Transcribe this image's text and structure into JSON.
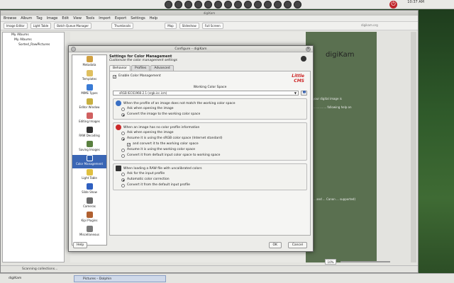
{
  "top_panel": {
    "clock": "10:37 AM"
  },
  "background_window": {
    "title": "digiKam",
    "menu": [
      "Browse",
      "Album",
      "Tag",
      "Image",
      "Edit",
      "View",
      "Tools",
      "Import",
      "Export",
      "Settings",
      "Help"
    ],
    "toolbar": [
      "Image Editor",
      "Light Table",
      "Batch Queue Manager",
      "Thumbnails",
      "Map",
      "Slideshow",
      "Full Screen"
    ],
    "tree": [
      "My Albums",
      "My Albums",
      "Sorted_RawPictures"
    ],
    "brand": "digiKam",
    "brand_domain": "digikam.org",
    "side_text": "your digital image is",
    "side_text2": "... ... ... ... following help on",
    "side_text3": "... and ... Canon ... supported)",
    "status": "Scanning collections...",
    "zoom": "10%"
  },
  "dialog": {
    "title": "Configure – digiKam",
    "heading": "Settings for Color Management",
    "subheading": "Customize the color management settings",
    "sidebar": [
      {
        "label": "Metadata",
        "color": "#d0a040"
      },
      {
        "label": "Templates",
        "color": "#e0c060"
      },
      {
        "label": "MIME Types",
        "color": "#3a7bd5"
      },
      {
        "label": "Editor Window",
        "color": "#c8b040"
      },
      {
        "label": "Editing Images",
        "color": "#d06060"
      },
      {
        "label": "RAW Decoding",
        "color": "#333333"
      },
      {
        "label": "Saving Images",
        "color": "#5a8040"
      },
      {
        "label": "Color Management",
        "color": "#2f5fb0"
      },
      {
        "label": "Light Table",
        "color": "#e0c040"
      },
      {
        "label": "Slide Show",
        "color": "#3060c0"
      },
      {
        "label": "Cameras",
        "color": "#6a6a6a"
      },
      {
        "label": "Kipi Plugins",
        "color": "#b06030"
      },
      {
        "label": "Miscellaneous",
        "color": "#7a7a7a"
      }
    ],
    "tabs": [
      "Behavior",
      "Profiles",
      "Advanced"
    ],
    "enable_label": "Enable Color Management",
    "logo": "Little CMS",
    "workspace_label": "Working Color Space",
    "workspace_value": "sRGB IEC61966-2.1 (srgb.icc.icm)",
    "mismatch": {
      "title": "When the profile of an image does not match the working color space",
      "options": [
        "Ask when opening the image",
        "Convert the image to the working color space"
      ],
      "selected": 1
    },
    "no_profile": {
      "title": "When an image has no color profile information",
      "options": [
        "Ask when opening the image",
        "Assume it is using the sRGB color space (Internet standard)",
        "and convert it to the working color space",
        "Assume it is using the working color space",
        "Convert it from default input color space to working space"
      ],
      "selected": 1
    },
    "raw": {
      "title": "When loading a RAW file with uncalibrated colors",
      "options": [
        "Ask for the input profile",
        "Automatic color correction",
        "Convert it from the default input profile"
      ],
      "selected": 1
    },
    "help_label": "Help",
    "ok_label": "OK",
    "cancel_label": "Cancel"
  },
  "taskbar": {
    "left": "digiKam",
    "active_task": "Pictures – Dolphin"
  }
}
